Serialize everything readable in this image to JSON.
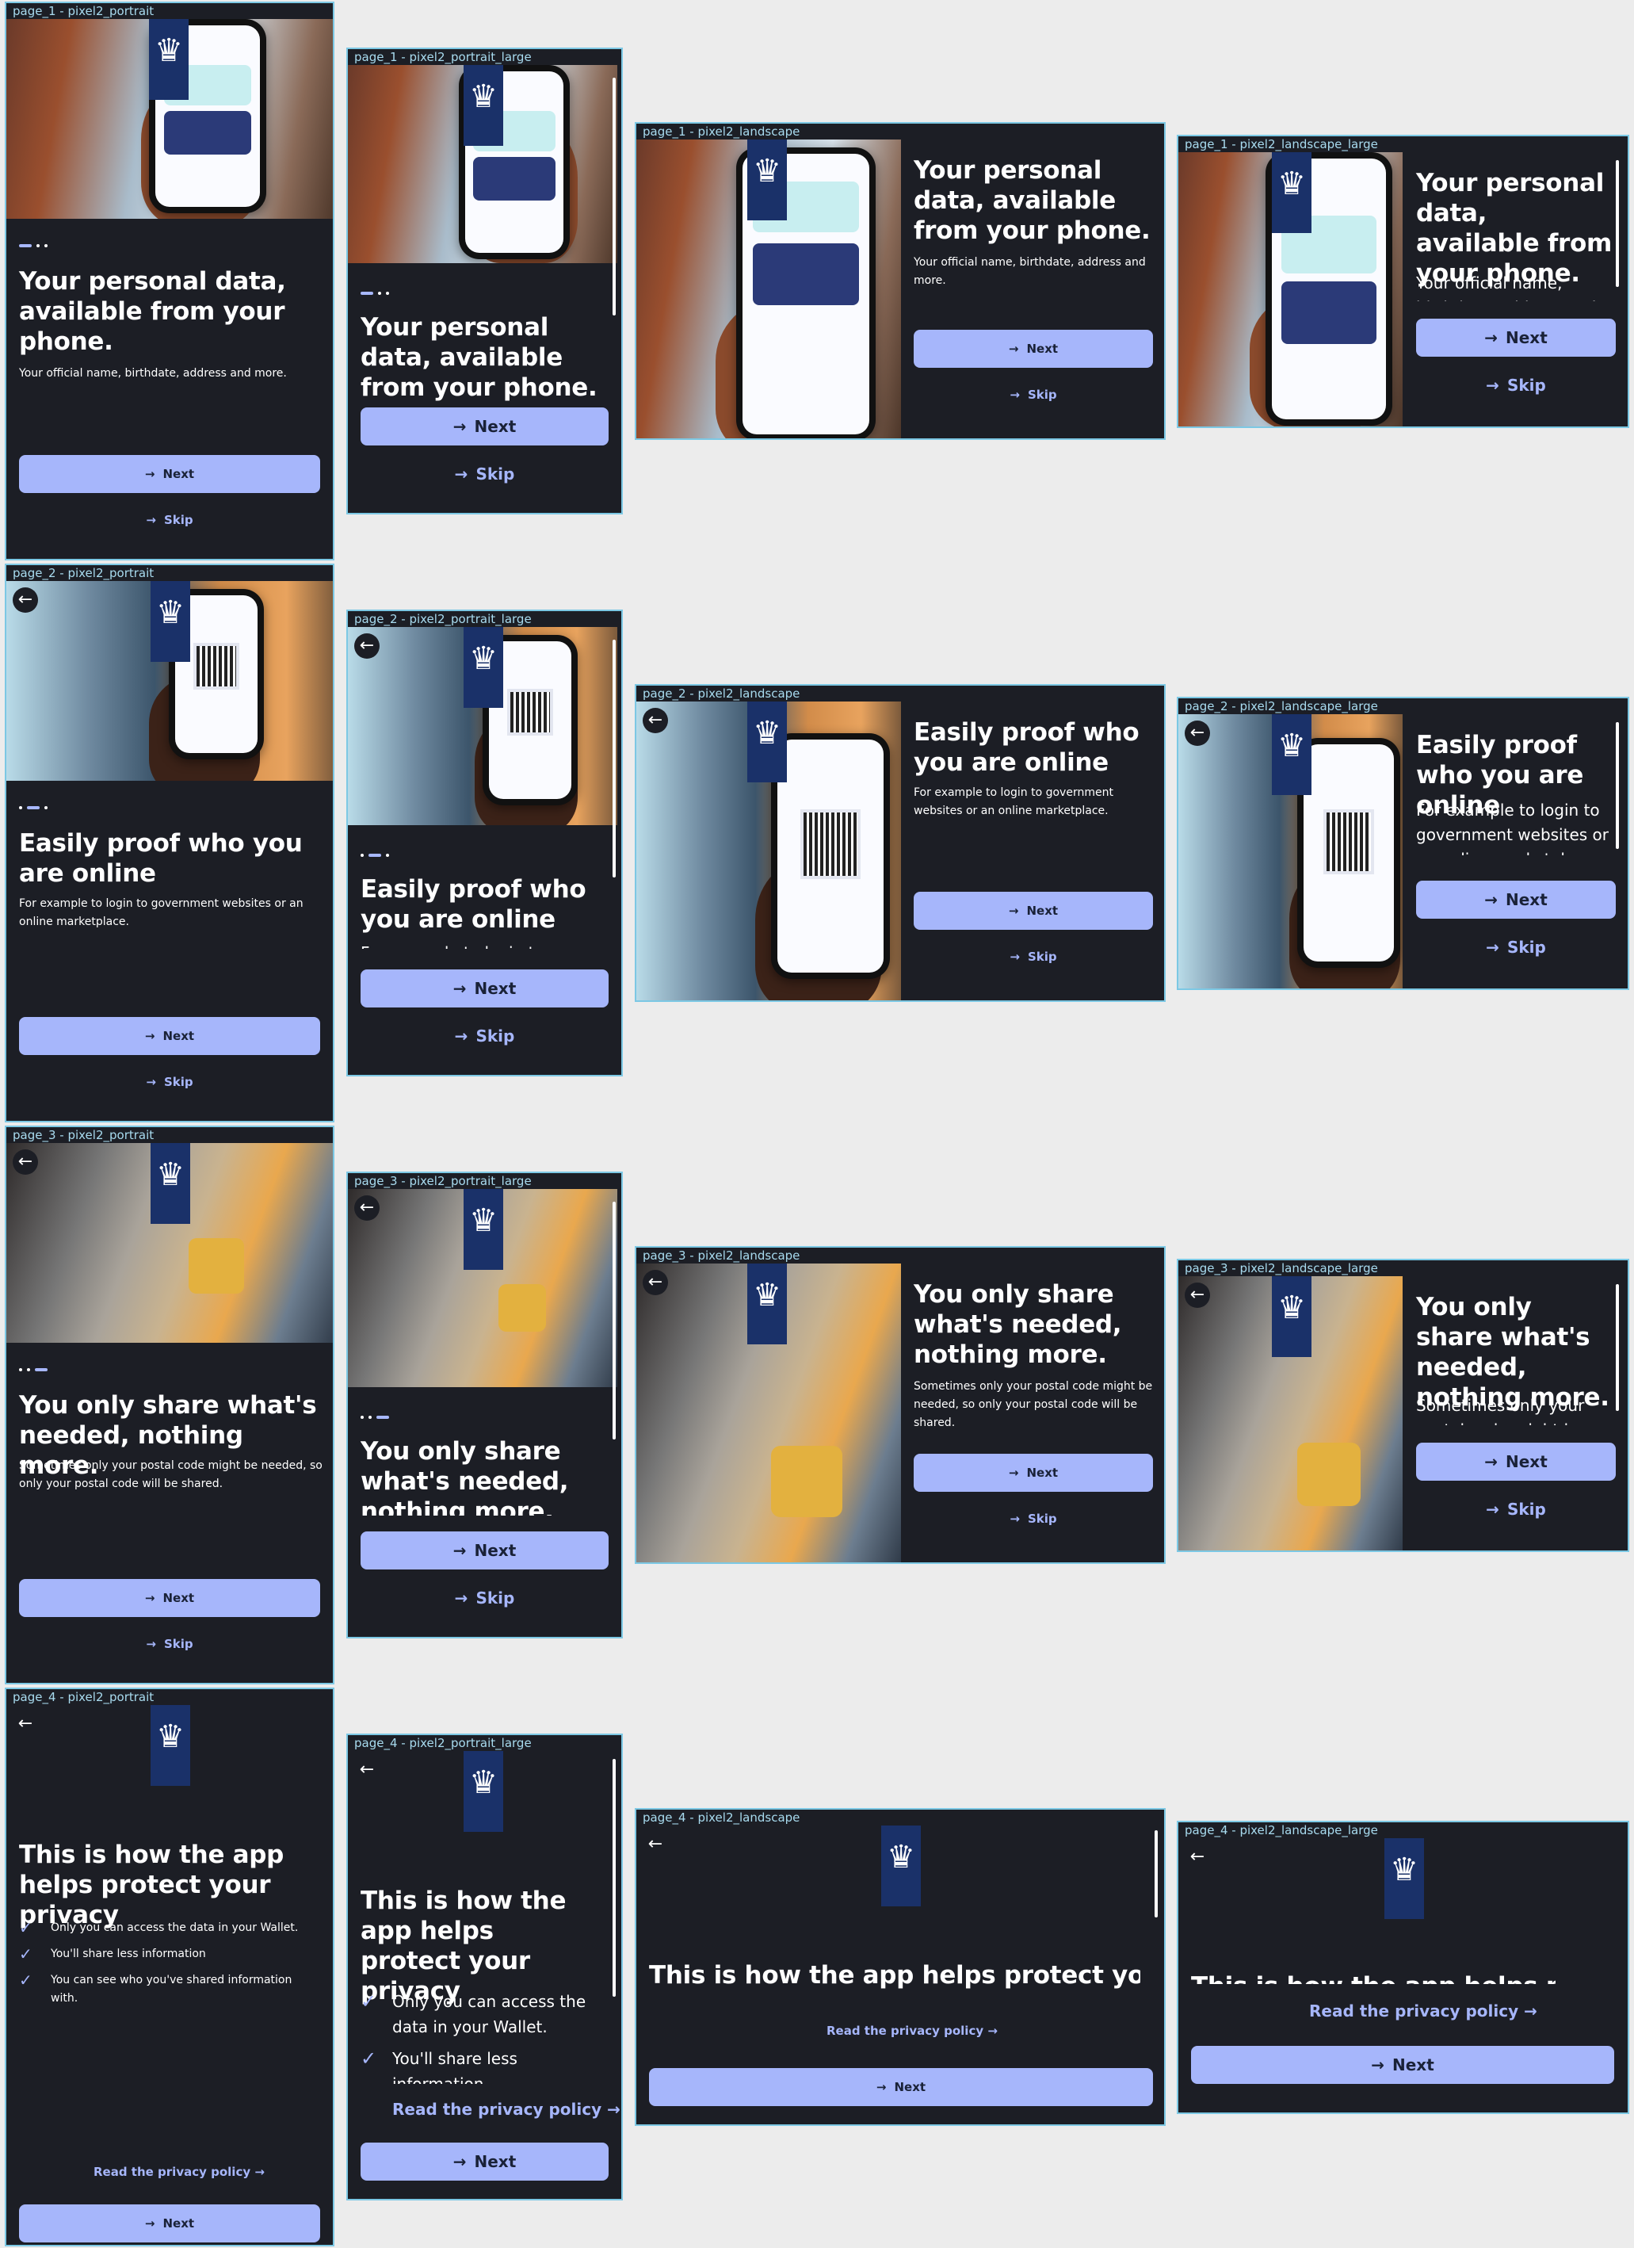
{
  "frames": {
    "p1_portrait": "page_1 - pixel2_portrait",
    "p1_portrait_large": "page_1 - pixel2_portrait_large",
    "p1_landscape": "page_1 - pixel2_landscape",
    "p1_landscape_large": "page_1 - pixel2_landscape_large",
    "p2_portrait": "page_2 - pixel2_portrait",
    "p2_portrait_large": "page_2 - pixel2_portrait_large",
    "p2_landscape": "page_2 - pixel2_landscape",
    "p2_landscape_large": "page_2 - pixel2_landscape_large",
    "p3_portrait": "page_3 - pixel2_portrait",
    "p3_portrait_large": "page_3 - pixel2_portrait_large",
    "p3_landscape": "page_3 - pixel2_landscape",
    "p3_landscape_large": "page_3 - pixel2_landscape_large",
    "p4_portrait": "page_4 - pixel2_portrait",
    "p4_portrait_large": "page_4 - pixel2_portrait_large",
    "p4_landscape": "page_4 - pixel2_landscape",
    "p4_landscape_large": "page_4 - pixel2_landscape_large"
  },
  "page1": {
    "title": "Your personal data, available from your phone.",
    "subtitle": "Your official name, birthdate, address and more."
  },
  "page2": {
    "title": "Easily proof who you are online",
    "subtitle": "For example to login to government websites or an online marketplace."
  },
  "page3": {
    "title": "You only share what's needed, nothing more.",
    "subtitle": "Sometimes only your postal code might be needed, so only your postal code will be shared."
  },
  "page4": {
    "title": "This is how the app helps protect your privacy",
    "bullets": [
      "Only you can access the data in your Wallet.",
      "You'll share less information",
      "You can see who you've shared information with."
    ],
    "privacy_link": "Read the privacy policy"
  },
  "buttons": {
    "next": "Next",
    "skip": "Skip"
  },
  "icons": {
    "back": "arrow-left-icon",
    "next": "arrow-right-icon",
    "check": "check-icon",
    "logo": "rijksoverheid-logo"
  },
  "colors": {
    "background": "#1c1e25",
    "primary_button": "#a6b6fb",
    "logo_ribbon": "#1a3169",
    "frame_border": "#7cc8e4"
  }
}
